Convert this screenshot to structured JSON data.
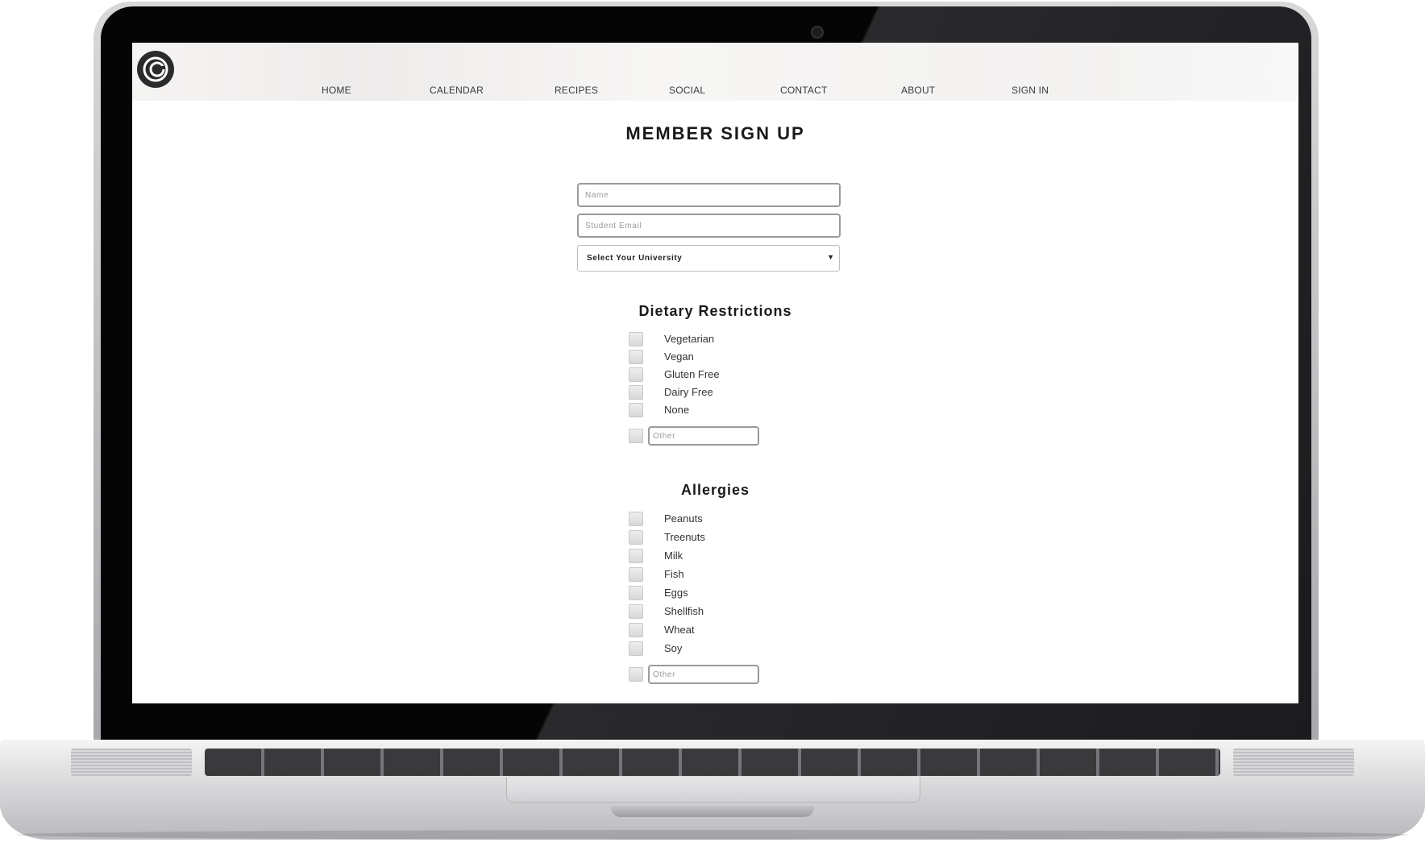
{
  "nav": {
    "items": [
      {
        "label": "HOME"
      },
      {
        "label": "CALENDAR"
      },
      {
        "label": "RECIPES"
      },
      {
        "label": "SOCIAL"
      },
      {
        "label": "CONTACT"
      },
      {
        "label": "ABOUT"
      },
      {
        "label": "SIGN IN"
      }
    ]
  },
  "page_title": "MEMBER SIGN UP",
  "form": {
    "name_placeholder": "Name",
    "email_placeholder": "Student Email",
    "university_select": "Select Your University"
  },
  "dietary": {
    "title": "Dietary Restrictions",
    "options": [
      "Vegetarian",
      "Vegan",
      "Gluten Free",
      "Dairy Free",
      "None"
    ],
    "other_placeholder": "Other"
  },
  "allergies": {
    "title": "Allergies",
    "options": [
      "Peanuts",
      "Treenuts",
      "Milk",
      "Fish",
      "Eggs",
      "Shellfish",
      "Wheat",
      "Soy"
    ],
    "other_placeholder": "Other"
  },
  "colors": {
    "accent": "#1a1a1a",
    "border": "#9a9a9a"
  }
}
